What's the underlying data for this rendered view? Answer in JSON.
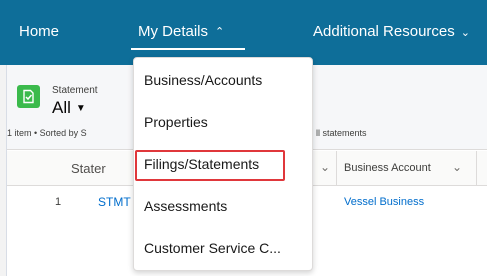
{
  "nav": {
    "home": "Home",
    "my_details": "My Details",
    "my_details_chevron": "⌃",
    "additional_resources": "Additional Resources",
    "additional_chevron": "⌄"
  },
  "list_view": {
    "object_label": "Statement",
    "view_name": "All",
    "view_caret": "▼",
    "meta_left": "1 item • Sorted by S",
    "meta_right": "ll statements",
    "columns": {
      "name": "Stater",
      "business_account": "Business Account"
    },
    "rows": [
      {
        "num": "1",
        "name": "STMT",
        "business_account": "Vessel Business"
      }
    ]
  },
  "menu": {
    "items": [
      "Business/Accounts",
      "Properties",
      "Filings/Statements",
      "Assessments",
      "Customer Service C..."
    ]
  },
  "colors": {
    "nav_bg": "#0e6e99",
    "icon_green": "#3bba4c",
    "link_blue": "#006dcc",
    "highlight_red": "#e0373b"
  }
}
